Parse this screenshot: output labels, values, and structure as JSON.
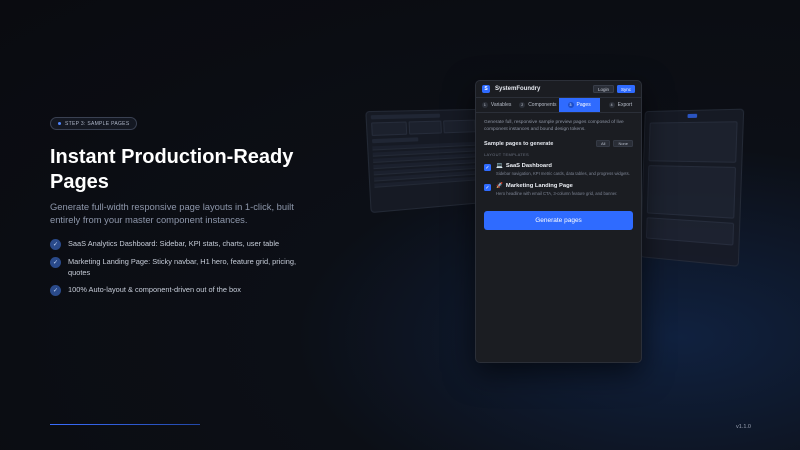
{
  "hero": {
    "step_badge": "STEP 3: SAMPLE PAGES",
    "title": "Instant Production-Ready Pages",
    "subtitle": "Generate full-width responsive page layouts in 1-click, built entirely from your master component instances.",
    "features": [
      "SaaS Analytics Dashboard: Sidebar, KPI stats, charts, user table",
      "Marketing Landing Page: Sticky navbar, H1 hero, feature grid, pricing, quotes",
      "100% Auto-layout & component-driven out of the box"
    ]
  },
  "version": "v1.1.0",
  "panel": {
    "brand": "SystemFoundry",
    "login_label": "Login",
    "sync_label": "Sync",
    "tabs": [
      {
        "num": "1",
        "label": "Variables"
      },
      {
        "num": "2",
        "label": "Components"
      },
      {
        "num": "3",
        "label": "Pages"
      },
      {
        "num": "4",
        "label": "Export"
      }
    ],
    "description": "Generate full, responsive sample preview pages composed of live component instances and bound design tokens.",
    "section_title": "Sample pages to generate",
    "all_label": "All",
    "none_label": "None",
    "group_label": "LAYOUT TEMPLATES",
    "templates": [
      {
        "icon": "💻",
        "name": "SaaS Dashboard",
        "desc": "Sidebar navigation, KPI metric cards, data tables, and progress widgets."
      },
      {
        "icon": "🚀",
        "name": "Marketing Landing Page",
        "desc": "Hero headline with email CTA, 3-column feature grid, and banner."
      }
    ],
    "generate_label": "Generate pages"
  },
  "colors": {
    "accent": "#2f6bff",
    "background": "#0c0f16"
  }
}
